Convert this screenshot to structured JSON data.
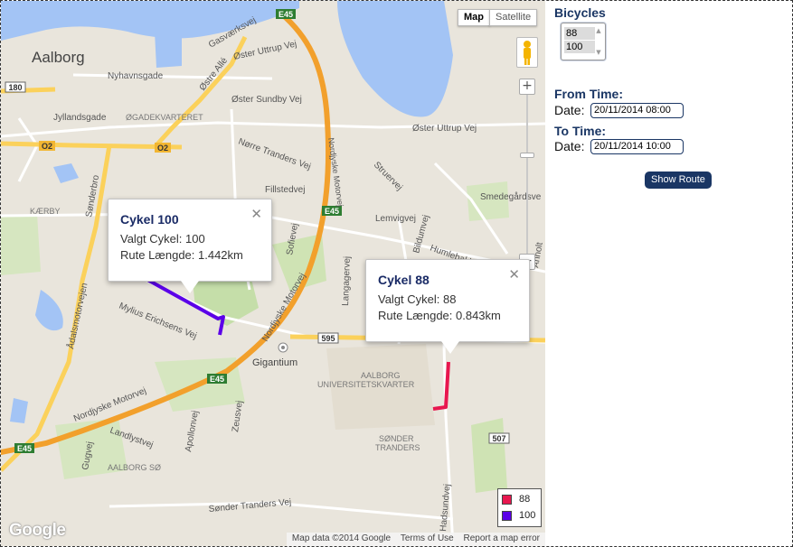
{
  "map": {
    "type_buttons": [
      "Map",
      "Satellite"
    ],
    "active_type": "Map",
    "labels": {
      "aalborg": "Aalborg",
      "nyhavnsgade": "Nyhavnsgade",
      "gasvaerksvej": "Gasværksvej",
      "ostre_alle": "Østre Allé",
      "oster_uttrup_vej": "Øster Uttrup Vej",
      "oster_sundby_vej": "Øster Sundby Vej",
      "jyllandsgade": "Jyllandsgade",
      "ogadekvarteret": "ØGADEKVARTERET",
      "norre_tranders_vej": "Nørre Tranders Vej",
      "fillstedvej": "Fillstedvej",
      "struervej": "Struervej",
      "smedegardsvej": "Smedegårdsve",
      "lemvigvej": "Lemvigvej",
      "bildumvej": "Bildumvej",
      "humlebakken": "Humlebakk",
      "anholt": "Anholt",
      "karby": "KÆRBY",
      "sonderbro": "Sønderbro",
      "sofievej": "Sofievej",
      "langagervej": "Langagervej",
      "nordjyske_motorvej": "Nordjyske Motorvej",
      "adalsmotorvejen": "Ådalsmotorvejen",
      "mylius": "Mylius Erichsens Vej",
      "gigantium": "Gigantium",
      "universitetskvarter_1": "AALBORG",
      "universitetskvarter_2": "UNIVERSITETSKVARTER",
      "sonder_1": "SØNDER",
      "sonder_2": "TRANDERS",
      "aalborg_so": "AALBORG SØ",
      "sonder_tranders_vej": "Sønder Tranders Vej",
      "hadsundvej": "Hadsundvej",
      "landlystvej": "Landlystvej",
      "apollonvej": "Apollonvej",
      "zeusvej": "Zeusvej",
      "gugvej": "Gugvej",
      "nordjyske_motorvej_2": "Nordjyske Motorvej"
    },
    "shields": {
      "e45_top": "E45",
      "r180": "180",
      "o2_left": "O2",
      "o2_right": "O2",
      "e45_mid": "E45",
      "r595": "595",
      "r595b": "595",
      "e45_low": "E45",
      "e45_left": "E45",
      "r507": "507"
    },
    "infowindows": [
      {
        "title": "Cykel 100",
        "line1": "Valgt Cykel: 100",
        "line2": "Rute Længde: 1.442km"
      },
      {
        "title": "Cykel 88",
        "line1": "Valgt Cykel: 88",
        "line2": "Rute Længde: 0.843km"
      }
    ],
    "legend": [
      {
        "label": "88",
        "color": "#e8174f"
      },
      {
        "label": "100",
        "color": "#5b00e8"
      }
    ],
    "attribution": [
      "Map data ©2014 Google",
      "Terms of Use",
      "Report a map error"
    ],
    "logo": "Google",
    "zoom_plus": "+",
    "zoom_minus": "−"
  },
  "panel": {
    "bicycles_heading": "Bicycles",
    "bicycle_options": [
      "88",
      "100"
    ],
    "from_heading": "From Time:",
    "from_label": "Date:",
    "from_value": "20/11/2014 08:00",
    "to_heading": "To Time:",
    "to_label": "Date:",
    "to_value": "20/11/2014 10:00",
    "show_route": "Show Route"
  },
  "colors": {
    "route_88": "#e8174f",
    "route_100": "#5b00e8",
    "heading": "#1a3664",
    "water": "#a3c4f5",
    "motorway": "#f2a02c"
  }
}
